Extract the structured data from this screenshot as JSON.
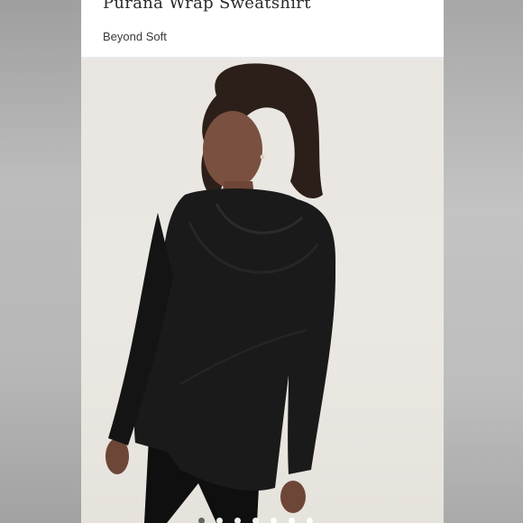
{
  "product": {
    "title": "Purana Wrap Sweatshirt",
    "subtitle": "Beyond Soft"
  },
  "image": {
    "description_icon": "product-photo"
  },
  "carousel": {
    "dot_count": 7,
    "active_index": 0,
    "active_color": "#5d5d5d",
    "inactive_color": "#ffffff"
  },
  "colors": {
    "page_background": "#c9c9c9",
    "card_background": "#ffffff",
    "photo_background": "#eae7e2",
    "garment": "#1a1a1a"
  }
}
